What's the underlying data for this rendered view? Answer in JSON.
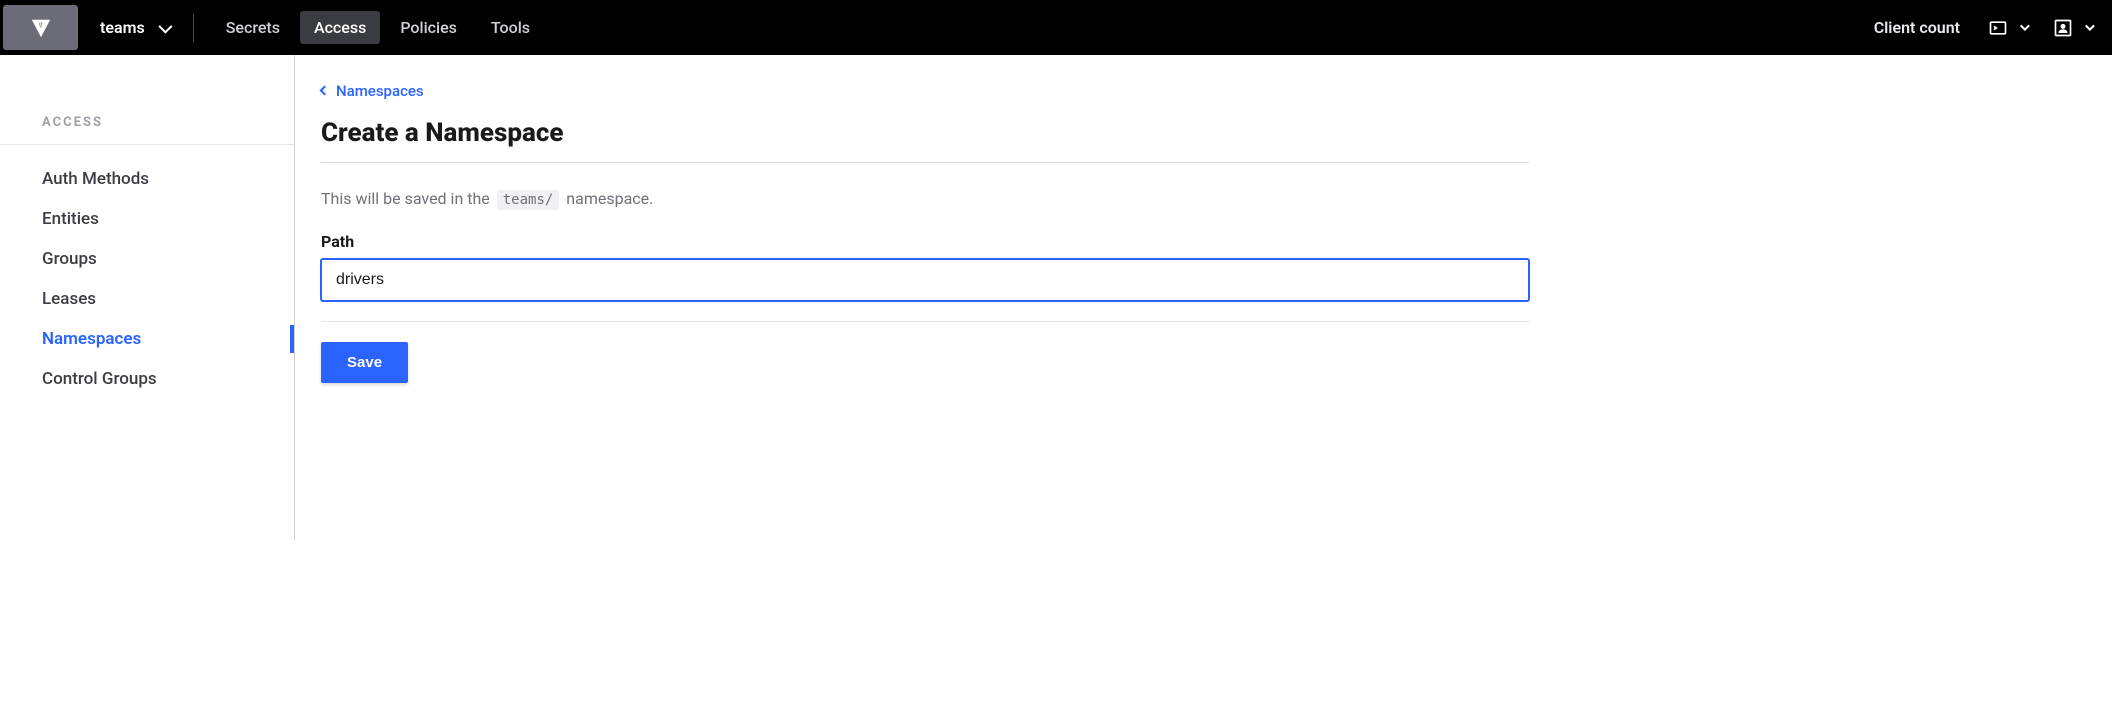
{
  "navbar": {
    "namespace_selector": "teams",
    "links": [
      {
        "label": "Secrets",
        "active": false
      },
      {
        "label": "Access",
        "active": true
      },
      {
        "label": "Policies",
        "active": false
      },
      {
        "label": "Tools",
        "active": false
      }
    ],
    "client_count_label": "Client count"
  },
  "sidebar": {
    "header": "ACCESS",
    "items": [
      {
        "label": "Auth Methods",
        "active": false
      },
      {
        "label": "Entities",
        "active": false
      },
      {
        "label": "Groups",
        "active": false
      },
      {
        "label": "Leases",
        "active": false
      },
      {
        "label": "Namespaces",
        "active": true
      },
      {
        "label": "Control Groups",
        "active": false
      }
    ]
  },
  "main": {
    "breadcrumb_label": "Namespaces",
    "title": "Create a Namespace",
    "help_prefix": "This will be saved in the ",
    "help_namespace": "teams/",
    "help_suffix": " namespace.",
    "path_label": "Path",
    "path_value": "drivers",
    "save_label": "Save"
  }
}
